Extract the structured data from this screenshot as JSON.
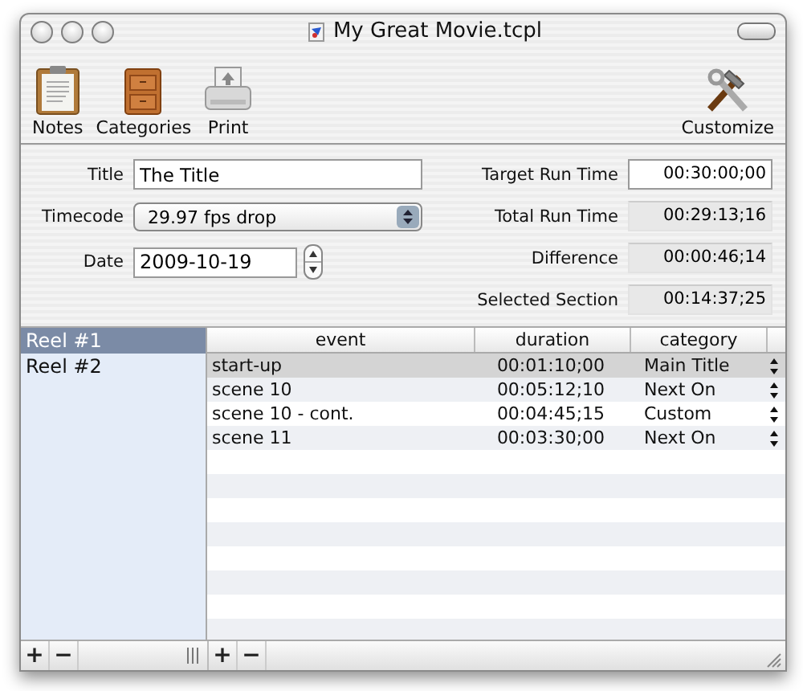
{
  "window": {
    "title": "My Great Movie.tcpl"
  },
  "toolbar": {
    "items": [
      {
        "label": "Notes",
        "kind": "notes"
      },
      {
        "label": "Categories",
        "kind": "categories"
      },
      {
        "label": "Print",
        "kind": "print"
      },
      {
        "label": "Customize",
        "kind": "customize"
      }
    ]
  },
  "form": {
    "title": {
      "label": "Title",
      "value": "The Title"
    },
    "timecode": {
      "label": "Timecode",
      "value": "29.97 fps drop"
    },
    "date": {
      "label": "Date",
      "value": "2009-10-19"
    }
  },
  "times": [
    {
      "label": "Target Run Time",
      "value": "00:30:00;00",
      "kind": "editable"
    },
    {
      "label": "Total Run Time",
      "value": "00:29:13;16",
      "kind": "readonly"
    },
    {
      "label": "Difference",
      "value": "00:00:46;14",
      "kind": "readonly"
    },
    {
      "label": "Selected Section",
      "value": "00:14:37;25",
      "kind": "readonly"
    }
  ],
  "reels": [
    {
      "label": "Reel #1",
      "selected": true
    },
    {
      "label": "Reel #2",
      "selected": false
    }
  ],
  "table": {
    "columns": [
      "event",
      "duration",
      "category"
    ],
    "rows": [
      {
        "event": "start-up",
        "duration": "00:01:10;00",
        "category": "Main Title",
        "selected": true
      },
      {
        "event": "scene 10",
        "duration": "00:05:12;10",
        "category": "Next On",
        "selected": false
      },
      {
        "event": "scene 10 - cont.",
        "duration": "00:04:45;15",
        "category": "Custom",
        "selected": false
      },
      {
        "event": "scene 11",
        "duration": "00:03:30;00",
        "category": "Next On",
        "selected": false
      }
    ]
  },
  "reel_buttons": [
    "+",
    "−"
  ],
  "event_buttons": [
    "+",
    "−"
  ]
}
